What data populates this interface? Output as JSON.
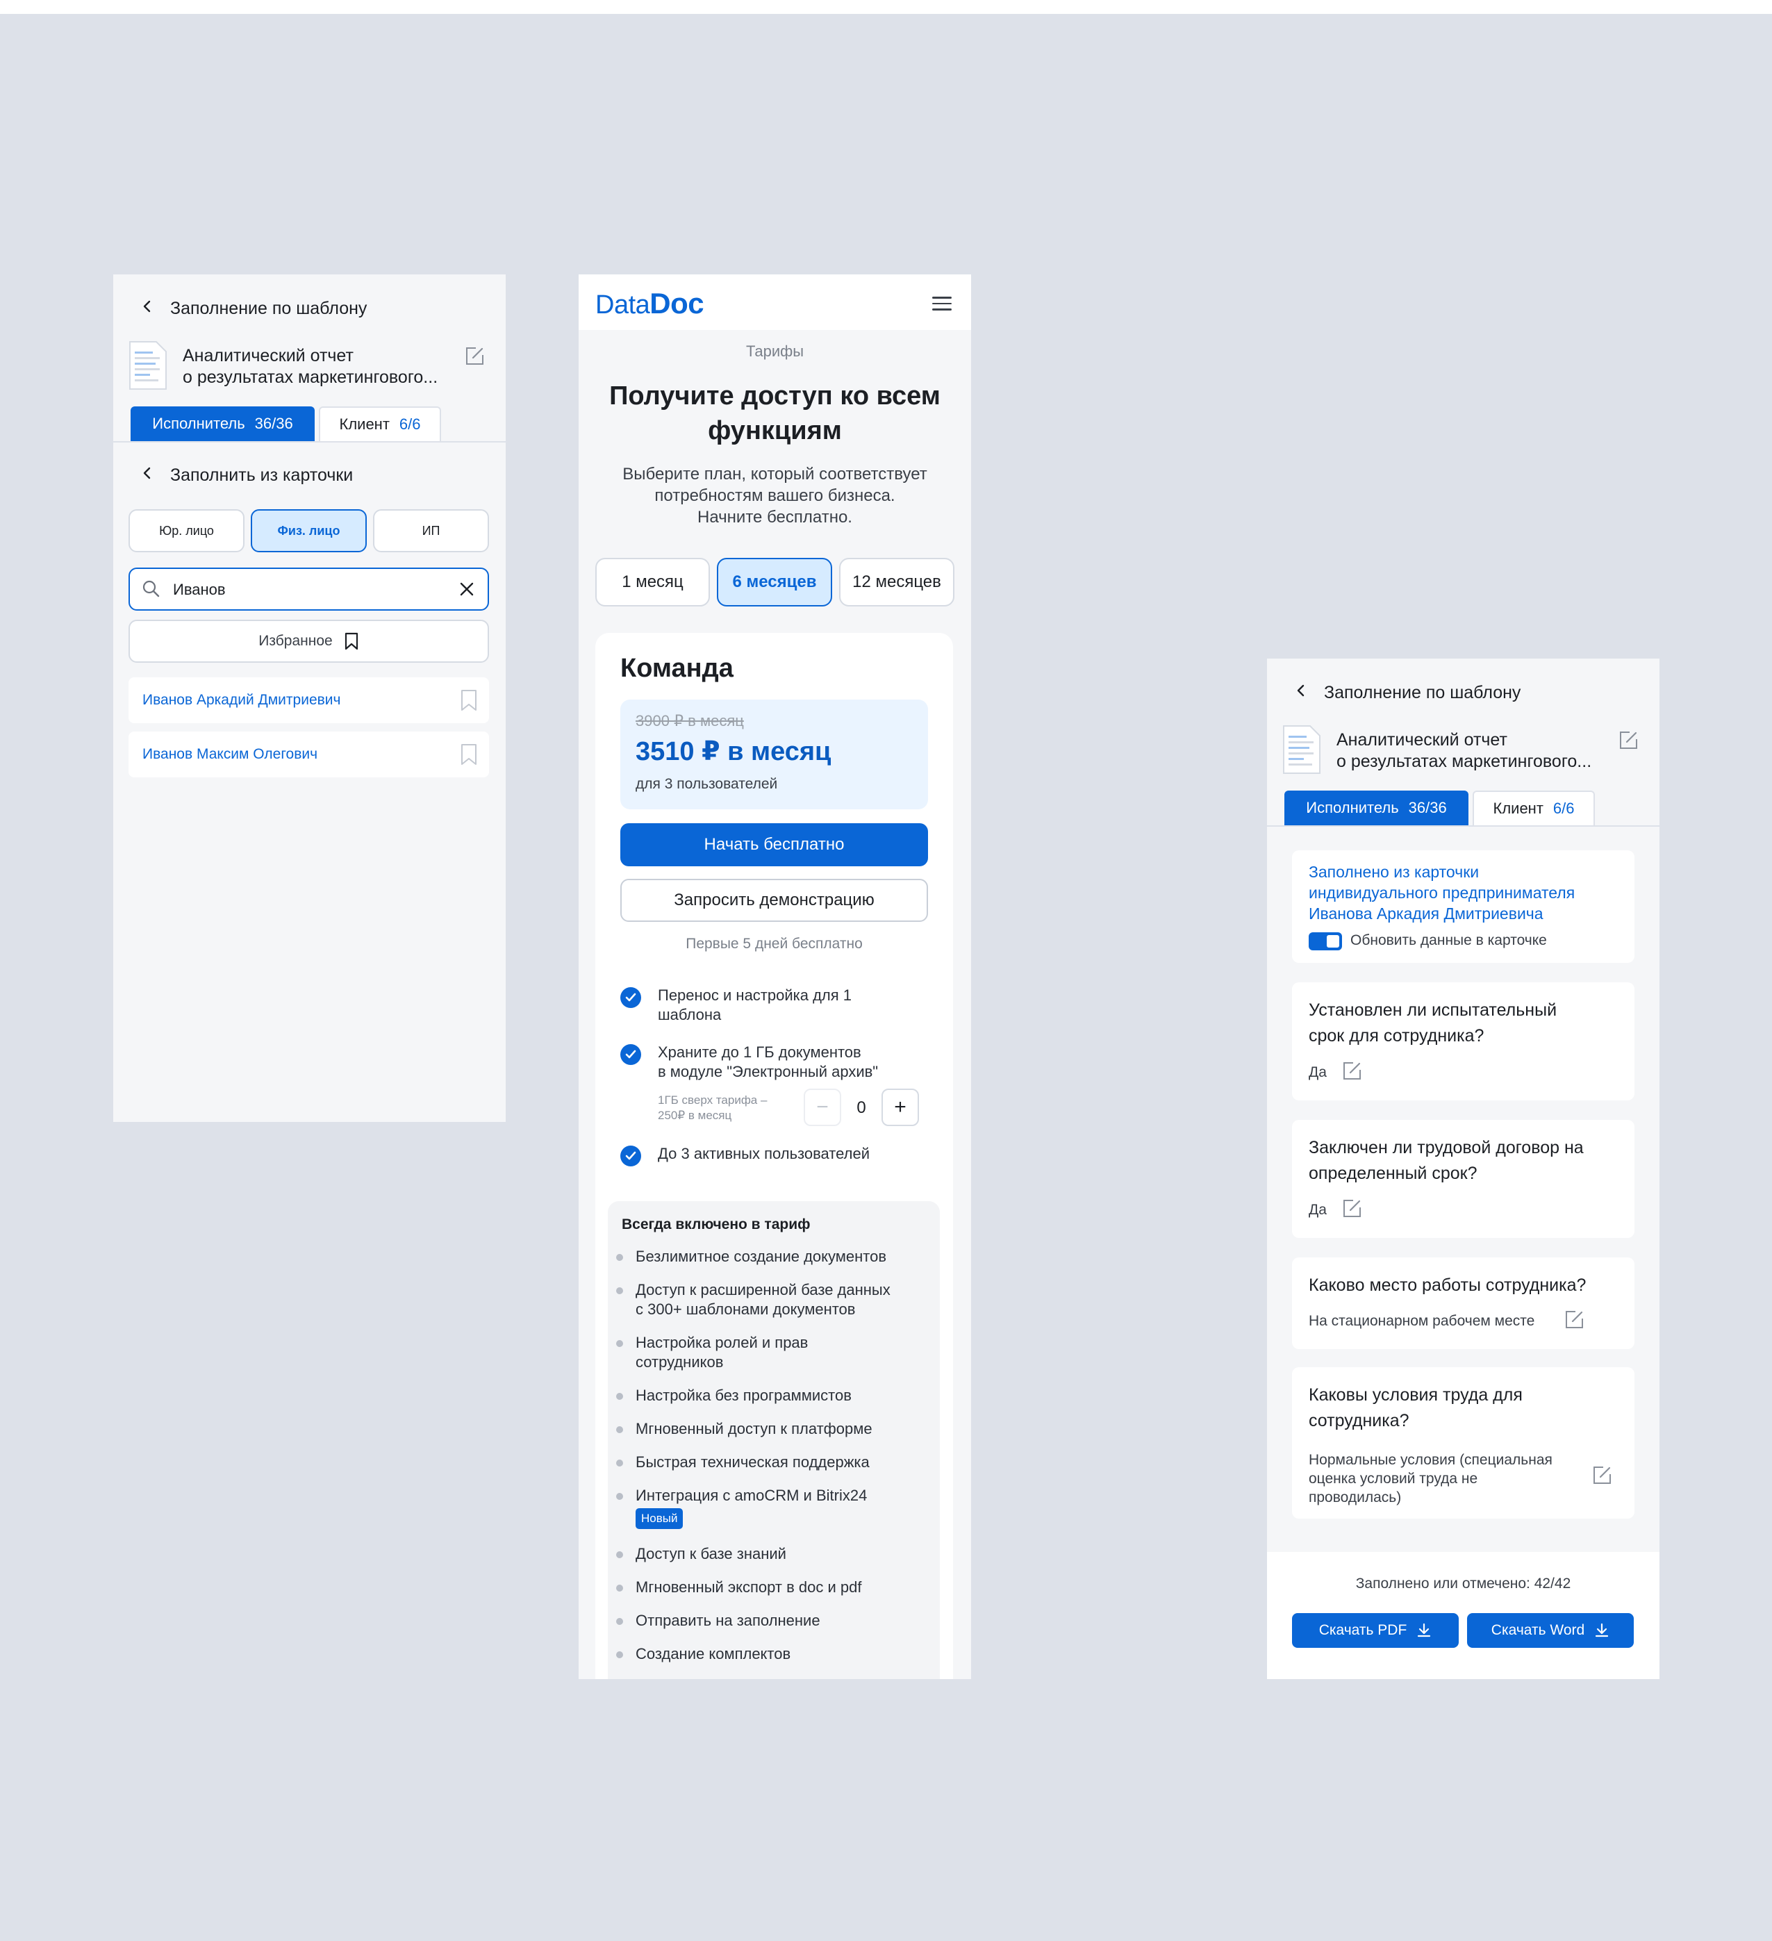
{
  "panel1": {
    "header": "Заполнение по шаблону",
    "doc_line1": "Аналитический отчет",
    "doc_line2": "о результатах маркетингового...",
    "tab_performer": "Исполнитель",
    "tab_performer_count": "36/36",
    "tab_client": "Клиент",
    "tab_client_count": "6/6",
    "subheader": "Заполнить из карточки",
    "segments": [
      "Юр. лицо",
      "Физ. лицо",
      "ИП"
    ],
    "search_value": "Иванов",
    "favorites": "Избранное",
    "persons": [
      "Иванов Аркадий Дмитриевич",
      "Иванов Максим Олегович"
    ]
  },
  "panel2": {
    "logo_a": "Data",
    "logo_b": "Doc",
    "breadcrumb": "Тарифы",
    "title_line1": "Получите доступ ко всем",
    "title_line2": "функциям",
    "subtitle_line1": "Выберите план, который соответствует",
    "subtitle_line2": "потребностям вашего бизнеса.",
    "subtitle_line3": "Начните бесплатно.",
    "periods": [
      "1 месяц",
      "6 месяцев",
      "12 месяцев"
    ],
    "plan_name": "Команда",
    "old_price": "3900 ₽ в месяц",
    "price": "3510 ₽ в месяц",
    "price_note": "для 3 пользователей",
    "start_btn": "Начать бесплатно",
    "demo_btn": "Запросить демонстрацию",
    "trial_note": "Первые 5 дней бесплатно",
    "feature1_l1": "Перенос и настройка для 1",
    "feature1_l2": "шаблона",
    "feature2_l1": "Храните до 1 ГБ документов",
    "feature2_l2": "в модуле \"Электронный архив\"",
    "extra_l1": "1ГБ сверх тарифа –",
    "extra_l2": "250₽ в месяц",
    "stepper_minus": "−",
    "stepper_value": "0",
    "stepper_plus": "+",
    "feature3": "До 3 активных пользователей",
    "included_title": "Всегда включено в тариф",
    "included": [
      "Безлимитное создание документов",
      "Доступ к расширенной базе данных",
      "с 300+ шаблонами документов",
      "Настройка ролей и прав",
      "сотрудников",
      "Настройка без программистов",
      "Мгновенный доступ к платформе",
      "Быстрая техническая поддержка",
      "Интеграция с amoCRM и Bitrix24",
      "Доступ к базе знаний",
      "Мгновенный экспорт в doc и pdf",
      "Отправить на заполнение",
      "Создание комплектов"
    ],
    "new_badge": "Новый"
  },
  "panel3": {
    "header": "Заполнение по шаблону",
    "doc_line1": "Аналитический отчет",
    "doc_line2": "о результатах маркетингового...",
    "tab_performer": "Исполнитель",
    "tab_performer_count": "36/36",
    "tab_client": "Клиент",
    "tab_client_count": "6/6",
    "filled_l1": "Заполнено из карточки",
    "filled_l2": "индивидуального предпринимателя",
    "filled_l3": "Иванова Аркадия Дмитриевича",
    "update_toggle": "Обновить данные в карточке",
    "q1_l1": "Установлен ли испытательный",
    "q1_l2": "срок для сотрудника?",
    "q1_answer": "Да",
    "q2_l1": "Заключен ли трудовой договор на",
    "q2_l2": "определенный срок?",
    "q2_answer": "Да",
    "q3_l1": "Каково место работы сотрудника?",
    "q3_answer": "На стационарном рабочем месте",
    "q4_l1": "Каковы условия труда для",
    "q4_l2": "сотрудника?",
    "q4_a1": "Нормальные условия (специальная",
    "q4_a2": "оценка условий труда не",
    "q4_a3": "проводилась)",
    "progress": "Заполнено или отмечено: 42/42",
    "btn_pdf": "Скачать PDF",
    "btn_word": "Скачать Word"
  },
  "colors": {
    "accent": "#0a66d6",
    "accent_light": "#d6ebff",
    "background": "#dde1e9"
  },
  "icons": [
    "chevron-left-icon",
    "document-icon",
    "edit-icon",
    "search-icon",
    "close-icon",
    "bookmark-icon",
    "menu-icon",
    "check-icon",
    "download-icon"
  ]
}
